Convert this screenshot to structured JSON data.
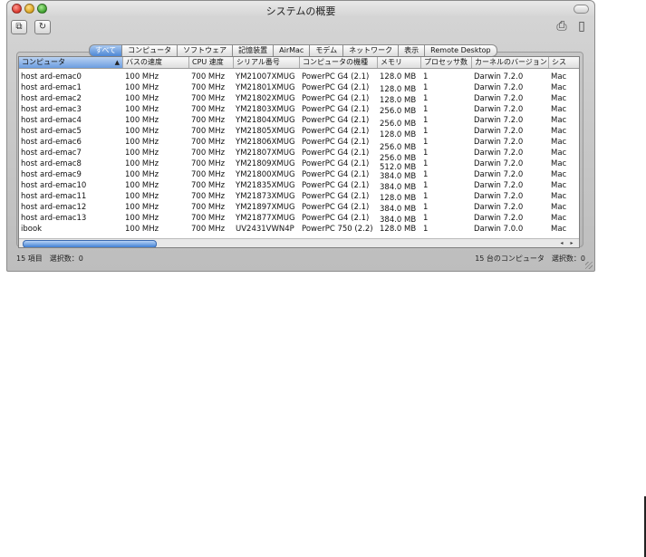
{
  "window": {
    "title": "システムの概要"
  },
  "toolbar": {
    "left_icons": [
      "window-icon",
      "refresh-icon"
    ],
    "right_icons": [
      "print-icon",
      "document-icon"
    ],
    "window_glyph": "⧉",
    "refresh_glyph": "↻",
    "print_glyph": "⎙",
    "doc_glyph": "▯"
  },
  "tabs": [
    "すべて",
    "コンピュータ",
    "ソフトウェア",
    "記憶装置",
    "AirMac",
    "モデム",
    "ネットワーク",
    "表示",
    "Remote Desktop"
  ],
  "table": {
    "columns": [
      "コンピュータ",
      "バスの速度",
      "CPU 速度",
      "シリアル番号",
      "コンピュータの機種",
      "メモリ",
      "プロセッサ数",
      "カーネルのバージョン",
      "シス"
    ],
    "sorted_column": "コンピュータ",
    "sort_glyph": "▲",
    "rows": [
      [
        "host ard-emac0",
        "100 MHz",
        "700 MHz",
        "YM21007XMUG",
        "PowerPC G4  (2.1)",
        "128.0 MB",
        "1",
        "Darwin 7.2.0",
        "Mac"
      ],
      [
        "host ard-emac1",
        "100 MHz",
        "700 MHz",
        "YM21801XMUG",
        "PowerPC G4  (2.1)",
        "128.0 MB",
        "1",
        "Darwin 7.2.0",
        "Mac"
      ],
      [
        "host ard-emac2",
        "100 MHz",
        "700 MHz",
        "YM21802XMUG",
        "PowerPC G4  (2.1)",
        "128.0 MB",
        "1",
        "Darwin 7.2.0",
        "Mac"
      ],
      [
        "host ard-emac3",
        "100 MHz",
        "700 MHz",
        "YM21803XMUG",
        "PowerPC G4  (2.1)",
        "256.0 MB",
        "1",
        "Darwin 7.2.0",
        "Mac"
      ],
      [
        "host ard-emac4",
        "100 MHz",
        "700 MHz",
        "YM21804XMUG",
        "PowerPC G4  (2.1)",
        "256.0 MB",
        "1",
        "Darwin 7.2.0",
        "Mac"
      ],
      [
        "host ard-emac5",
        "100 MHz",
        "700 MHz",
        "YM21805XMUG",
        "PowerPC G4  (2.1)",
        "128.0 MB",
        "1",
        "Darwin 7.2.0",
        "Mac"
      ],
      [
        "host ard-emac6",
        "100 MHz",
        "700 MHz",
        "YM21806XMUG",
        "PowerPC G4  (2.1)",
        "256.0 MB",
        "1",
        "Darwin 7.2.0",
        "Mac"
      ],
      [
        "host ard-emac7",
        "100 MHz",
        "700 MHz",
        "YM21807XMUG",
        "PowerPC G4  (2.1)",
        "256.0 MB",
        "1",
        "Darwin 7.2.0",
        "Mac"
      ],
      [
        "host ard-emac8",
        "100 MHz",
        "700 MHz",
        "YM21809XMUG",
        "PowerPC G4  (2.1)",
        "512.0 MB",
        "1",
        "Darwin 7.2.0",
        "Mac"
      ],
      [
        "host ard-emac9",
        "100 MHz",
        "700 MHz",
        "YM21800XMUG",
        "PowerPC G4  (2.1)",
        "384.0 MB",
        "1",
        "Darwin 7.2.0",
        "Mac"
      ],
      [
        "host ard-emac10",
        "100 MHz",
        "700 MHz",
        "YM21835XMUG",
        "PowerPC G4  (2.1)",
        "384.0 MB",
        "1",
        "Darwin 7.2.0",
        "Mac"
      ],
      [
        "host ard-emac11",
        "100 MHz",
        "700 MHz",
        "YM21873XMUG",
        "PowerPC G4  (2.1)",
        "128.0 MB",
        "1",
        "Darwin 7.2.0",
        "Mac"
      ],
      [
        "host ard-emac12",
        "100 MHz",
        "700 MHz",
        "YM21897XMUG",
        "PowerPC G4  (2.1)",
        "384.0 MB",
        "1",
        "Darwin 7.2.0",
        "Mac"
      ],
      [
        "host ard-emac13",
        "100 MHz",
        "700 MHz",
        "YM21877XMUG",
        "PowerPC G4  (2.1)",
        "384.0 MB",
        "1",
        "Darwin 7.2.0",
        "Mac"
      ],
      [
        "ibook",
        "100 MHz",
        "700 MHz",
        "UV2431VWN4P",
        "PowerPC 750  (2.2)",
        "128.0 MB",
        "1",
        "Darwin 7.0.0",
        "Mac"
      ]
    ]
  },
  "scrollbar": {
    "left_arrow": "◂",
    "right_arrow": "▸"
  },
  "status": {
    "left": "15 項目　選択数：0",
    "right": "15 台のコンピュータ　選択数：0"
  }
}
